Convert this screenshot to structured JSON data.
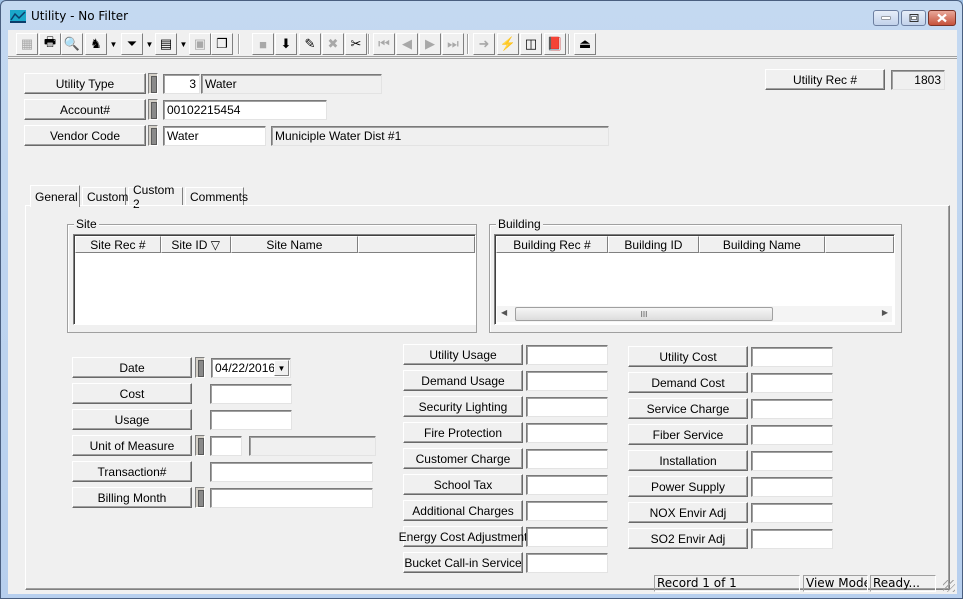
{
  "window": {
    "title": "Utility - No Filter",
    "icon": "chart-app-icon",
    "controls": [
      "minimize",
      "maximize",
      "close"
    ]
  },
  "toolbar": {
    "items": [
      {
        "name": "grid-view-icon",
        "glyph": "▦",
        "enabled": false
      },
      {
        "name": "print-icon",
        "glyph": "🖶",
        "enabled": true
      },
      {
        "name": "print-preview-icon",
        "glyph": "🔍",
        "enabled": true
      },
      {
        "name": "find-icon",
        "glyph": "♞",
        "enabled": true,
        "dropdown": true
      },
      {
        "name": "filter-icon",
        "glyph": "⏷",
        "enabled": true,
        "dropdown": true
      },
      {
        "name": "report-icon",
        "glyph": "▤",
        "enabled": true,
        "dropdown": true
      },
      {
        "name": "properties-icon",
        "glyph": "▣",
        "enabled": false
      },
      {
        "name": "copy-record-icon",
        "glyph": "❐",
        "enabled": true
      },
      {
        "name": "save-icon",
        "glyph": "■",
        "enabled": false
      },
      {
        "name": "add-record-icon",
        "glyph": "⬇",
        "enabled": true
      },
      {
        "name": "edit-icon",
        "glyph": "✎",
        "enabled": true
      },
      {
        "name": "cancel-icon",
        "glyph": "✖",
        "enabled": false
      },
      {
        "name": "cut-icon",
        "glyph": "✂",
        "enabled": true
      },
      {
        "name": "first-record-icon",
        "glyph": "⏮",
        "enabled": false
      },
      {
        "name": "previous-record-icon",
        "glyph": "◀",
        "enabled": false
      },
      {
        "name": "next-record-icon",
        "glyph": "▶",
        "enabled": false
      },
      {
        "name": "last-record-icon",
        "glyph": "⏭",
        "enabled": false
      },
      {
        "name": "goto-icon",
        "glyph": "➜",
        "enabled": false
      },
      {
        "name": "quick-action-icon",
        "glyph": "⚡",
        "enabled": true
      },
      {
        "name": "relationship-icon",
        "glyph": "◫",
        "enabled": true
      },
      {
        "name": "help-book-icon",
        "glyph": "📕",
        "enabled": true
      },
      {
        "name": "exit-icon",
        "glyph": "⏏",
        "enabled": true
      }
    ]
  },
  "header": {
    "utility_type": {
      "label": "Utility Type",
      "code": "3",
      "description": "Water"
    },
    "account": {
      "label": "Account#",
      "value": "00102215454"
    },
    "vendor_code": {
      "label": "Vendor Code",
      "code": "Water",
      "description": "Municiple Water Dist #1"
    },
    "utility_rec": {
      "label": "Utility Rec #",
      "value": "1803"
    }
  },
  "tabs": [
    {
      "label": "General",
      "active": true
    },
    {
      "label": "Custom",
      "active": false
    },
    {
      "label": "Custom 2",
      "active": false
    },
    {
      "label": "Comments",
      "active": false
    }
  ],
  "site": {
    "legend": "Site",
    "columns": [
      "Site Rec #",
      "Site ID ▽",
      "Site Name",
      ""
    ],
    "rows": []
  },
  "building": {
    "legend": "Building",
    "columns": [
      "Building Rec #",
      "Building ID",
      "Building Name",
      ""
    ],
    "rows": [],
    "scroll_thumb_glyph": "III"
  },
  "general": {
    "left": [
      {
        "label": "Date",
        "value": "04/22/2016",
        "lookup": true
      },
      {
        "label": "Cost",
        "value": ""
      },
      {
        "label": "Usage",
        "value": ""
      },
      {
        "label": "Unit of Measure",
        "value": "",
        "description": "",
        "lookup": true
      },
      {
        "label": "Transaction#",
        "value": ""
      },
      {
        "label": "Billing Month",
        "value": "",
        "lookup": true
      }
    ],
    "middle": [
      {
        "label": "Utility Usage",
        "value": ""
      },
      {
        "label": "Demand Usage",
        "value": ""
      },
      {
        "label": "Security Lighting",
        "value": ""
      },
      {
        "label": "Fire Protection",
        "value": ""
      },
      {
        "label": "Customer Charge",
        "value": ""
      },
      {
        "label": "School Tax",
        "value": ""
      },
      {
        "label": "Additional Charges",
        "value": ""
      },
      {
        "label": "Energy Cost Adjustment",
        "value": ""
      },
      {
        "label": "Bucket Call-in Service",
        "value": ""
      }
    ],
    "right": [
      {
        "label": "Utility Cost",
        "value": ""
      },
      {
        "label": "Demand Cost",
        "value": ""
      },
      {
        "label": "Service Charge",
        "value": ""
      },
      {
        "label": "Fiber Service",
        "value": ""
      },
      {
        "label": "Installation",
        "value": ""
      },
      {
        "label": "Power Supply",
        "value": ""
      },
      {
        "label": "NOX Envir Adj",
        "value": ""
      },
      {
        "label": "SO2 Envir Adj",
        "value": ""
      }
    ]
  },
  "status": {
    "record": "Record 1 of 1",
    "mode": "View Mode",
    "state": "Ready..."
  }
}
